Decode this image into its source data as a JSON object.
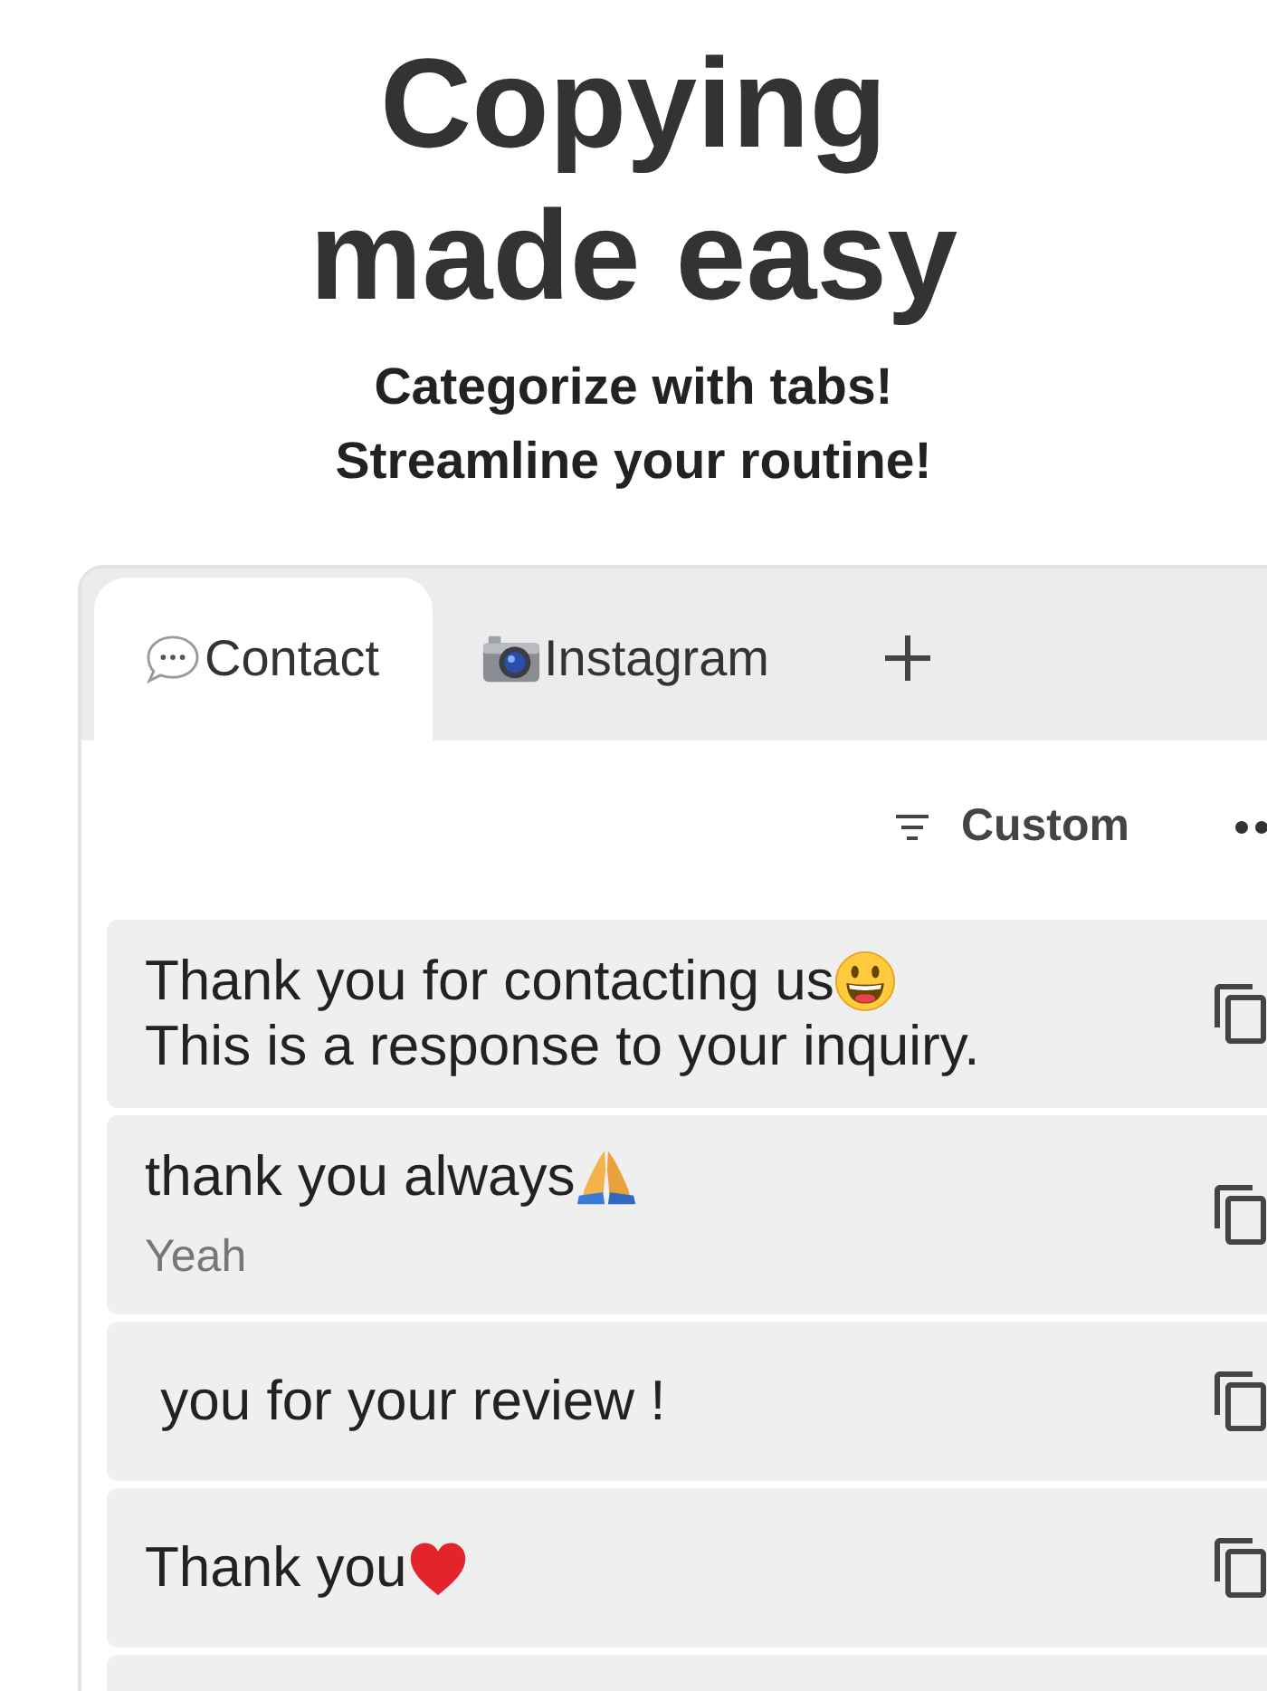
{
  "heading": "Copying made easy",
  "subtitle": [
    "Categorize with tabs!",
    "Streamline your routine!"
  ],
  "tabs": [
    {
      "label": "Contact",
      "kind": "chat",
      "selected": true
    },
    {
      "label": "Instagram",
      "kind": "camera",
      "selected": false
    }
  ],
  "sort": {
    "label": "Custom"
  },
  "templates": [
    {
      "lines": [
        {
          "text": "Thank you for contacting us",
          "kind": "smiley"
        },
        {
          "text": "This is a response to your inquiry.",
          "kind": "plain"
        }
      ]
    },
    {
      "lines": [
        {
          "text": "thank you always",
          "kind": "pray"
        }
      ],
      "memo": "Yeah"
    },
    {
      "lines": [
        {
          "text": " you for your review !",
          "kind": "plain"
        }
      ]
    },
    {
      "lines": [
        {
          "text": "Thank you",
          "kind": "heart"
        }
      ]
    }
  ]
}
